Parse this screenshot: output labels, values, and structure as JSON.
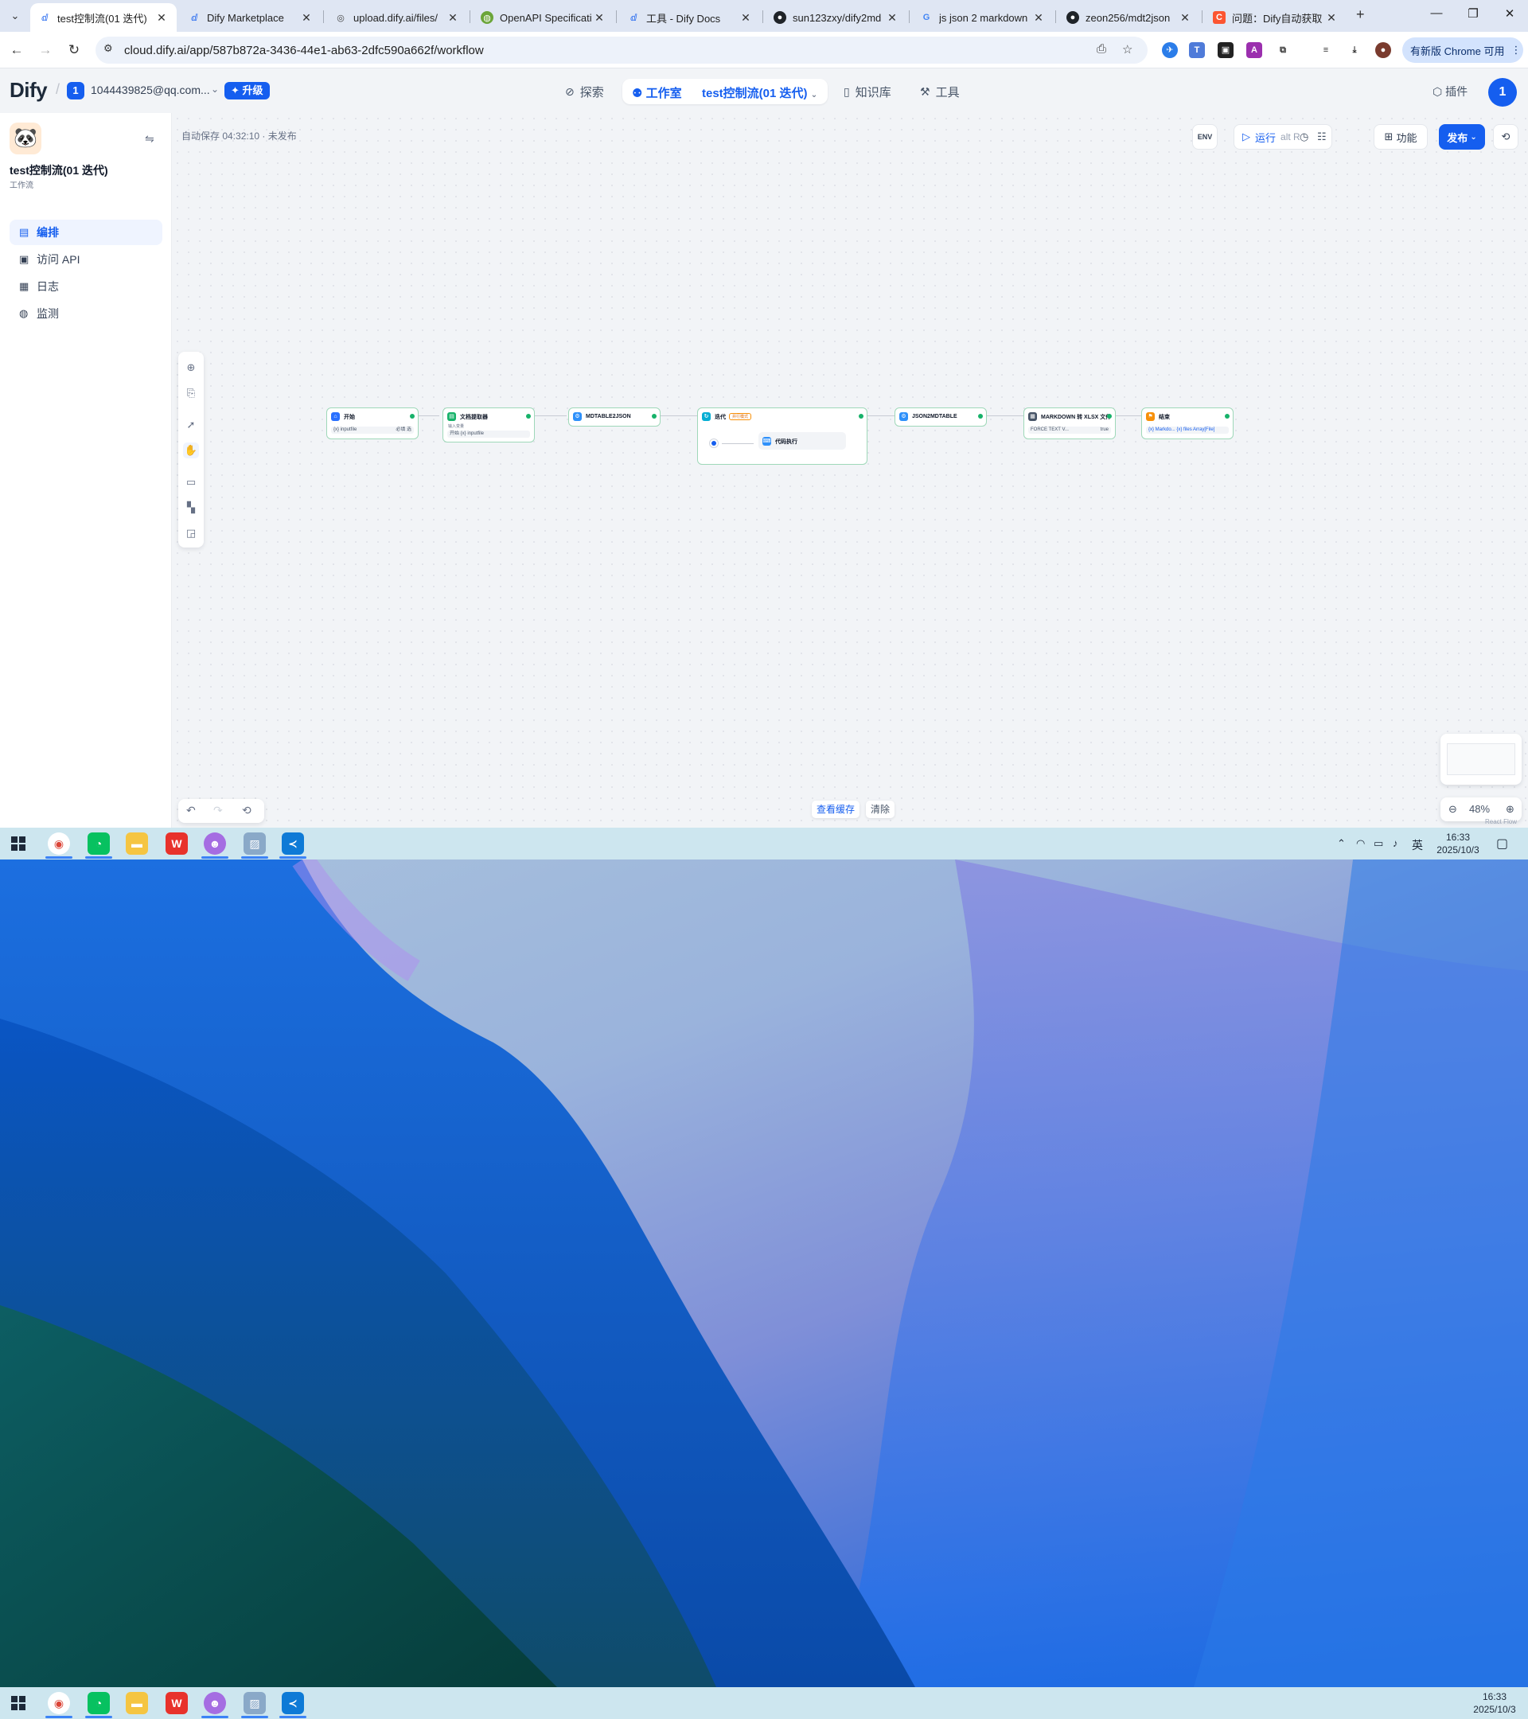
{
  "browser": {
    "tabs": [
      {
        "title": "test控制流(01 迭代)",
        "icon": "dify-icon",
        "active": true
      },
      {
        "title": "Dify Marketplace",
        "icon": "dify-icon"
      },
      {
        "title": "upload.dify.ai/files/",
        "icon": "globe-icon"
      },
      {
        "title": "OpenAPI Specificati",
        "icon": "openapi-icon"
      },
      {
        "title": "工具 - Dify Docs",
        "icon": "dify-icon"
      },
      {
        "title": "sun123zxy/dify2md",
        "icon": "github-icon"
      },
      {
        "title": "js json 2 markdown",
        "icon": "google-icon"
      },
      {
        "title": "zeon256/mdt2json",
        "icon": "github-icon"
      },
      {
        "title": "问题：Dify自动获取",
        "icon": "csdn-icon"
      }
    ],
    "url": "cloud.dify.ai/app/587b872a-3436-44e1-ab63-2dfc590a662f/workflow",
    "update_label": "有新版 Chrome 可用"
  },
  "app": {
    "logo": "Dify",
    "workspace_avatar": "1",
    "workspace_email": "1044439825@qq.com...",
    "upgrade_label": "升级",
    "nav": {
      "explore": "探索",
      "studio": "工作室",
      "current_app": "test控制流(01 迭代)",
      "knowledge": "知识库",
      "tools": "工具"
    },
    "plugins_label": "插件",
    "user_avatar": "1"
  },
  "sidebar": {
    "app_title": "test控制流(01 迭代)",
    "app_type": "工作流",
    "items": [
      {
        "label": "编排",
        "icon": "layout-icon",
        "active": true
      },
      {
        "label": "访问 API",
        "icon": "terminal-icon"
      },
      {
        "label": "日志",
        "icon": "logs-icon"
      },
      {
        "label": "监测",
        "icon": "monitor-icon"
      }
    ]
  },
  "canvas": {
    "autosave": "自动保存 04:32:10 · 未发布",
    "env_label": "ENV",
    "run_label": "运行",
    "run_shortcut": "alt  R",
    "features_label": "功能",
    "publish_label": "发布",
    "view_cache_label": "查看缓存",
    "clear_label": "清除",
    "zoom": "48%",
    "attribution": "React Flow"
  },
  "workflow": {
    "nodes": [
      {
        "title": "开始",
        "var": "{x} inputfile",
        "extra": "必填 选",
        "icon_color": "#2970ff"
      },
      {
        "title": "文档提取器",
        "var": "开始  {x} inputfile",
        "sub": "输入变量",
        "icon_color": "#17b26a"
      },
      {
        "title": "MDTABLE2JSON",
        "var": "",
        "icon_color": "#2e90fa"
      },
      {
        "title": "迭代",
        "badge": "并行模式",
        "inner": "代码执行",
        "icon_color": "#06aed4"
      },
      {
        "title": "JSON2MDTABLE",
        "var": "",
        "icon_color": "#2e90fa"
      },
      {
        "title": "MARKDOWN 转 XLSX 文件",
        "var": "FORCE TEXT V...",
        "extra": "true",
        "icon_color": "#475467"
      },
      {
        "title": "结束",
        "var": "{x} Markdo...  {x} files Array[File]",
        "icon_color": "#f79009"
      }
    ]
  },
  "taskbar": {
    "time": "16:33",
    "date": "2025/10/3",
    "ime": "英",
    "apps": [
      "chrome-icon",
      "wechat-icon",
      "file-explorer-icon",
      "wps-icon",
      "pet-app-icon",
      "photos-icon",
      "vscode-icon"
    ]
  }
}
